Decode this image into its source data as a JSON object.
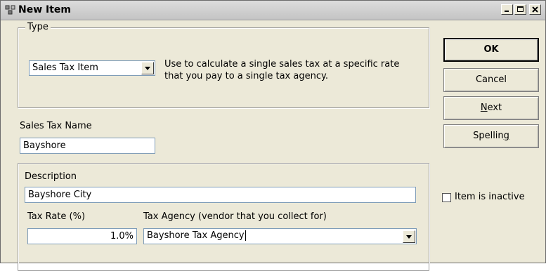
{
  "window": {
    "title": "New Item",
    "controls": {
      "minimize": "minimize-icon",
      "maximize": "maximize-icon",
      "close": "close-icon"
    }
  },
  "type_group": {
    "legend": "Type",
    "selected": "Sales Tax Item",
    "description_line1": "Use to calculate a single sales tax at a specific rate",
    "description_line2": "that you pay to a single tax agency."
  },
  "sales_tax_name": {
    "label": "Sales Tax Name",
    "value": "Bayshore"
  },
  "details": {
    "description_label": "Description",
    "description_value": "Bayshore City",
    "tax_rate_label": "Tax Rate (%)",
    "tax_rate_value": "1.0%",
    "tax_agency_label": "Tax Agency (vendor that you collect for)",
    "tax_agency_value": "Bayshore Tax Agency"
  },
  "buttons": {
    "ok": "OK",
    "cancel": "Cancel",
    "next_first": "N",
    "next_rest": "ext",
    "spelling_main": "Spellin",
    "spelling_mnemonic": "g"
  },
  "inactive_checkbox": {
    "label": "Item is inactive",
    "checked": false
  }
}
